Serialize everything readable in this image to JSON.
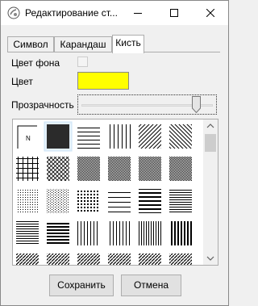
{
  "window": {
    "title": "Редактирование ст...",
    "controls": [
      "minimize-icon",
      "maximize-icon",
      "close-icon"
    ]
  },
  "tabs": [
    {
      "label": "Символ",
      "active": false
    },
    {
      "label": "Карандаш",
      "active": false
    },
    {
      "label": "Кисть",
      "active": true
    }
  ],
  "form": {
    "background_color_label": "Цвет фона",
    "background_color_checked": false,
    "color_label": "Цвет",
    "color_value": "#ffff00",
    "transparency_label": "Прозрачность",
    "transparency_fraction": 0.88
  },
  "patterns": {
    "selected_index": 1,
    "items": [
      {
        "type": "none",
        "glyph": "N"
      },
      {
        "type": "solid"
      },
      {
        "type": "horizontal"
      },
      {
        "type": "vertical"
      },
      {
        "type": "fdiag"
      },
      {
        "type": "bdiag"
      },
      {
        "type": "cross"
      },
      {
        "type": "diagcross"
      },
      {
        "type": "dense-dots"
      },
      {
        "type": "dense-dots"
      },
      {
        "type": "dense-dots"
      },
      {
        "type": "dense-dots"
      },
      {
        "type": "dots-fine"
      },
      {
        "type": "dots-medium"
      },
      {
        "type": "dots-coarse"
      },
      {
        "type": "horizontal-wide"
      },
      {
        "type": "horizontal-bold"
      },
      {
        "type": "horizontal-dense"
      },
      {
        "type": "horizontal-dense"
      },
      {
        "type": "horizontal-narrow"
      },
      {
        "type": "vertical-fine"
      },
      {
        "type": "vertical-fine"
      },
      {
        "type": "vertical-medium"
      },
      {
        "type": "vertical-bold"
      },
      {
        "type": "diag-short"
      },
      {
        "type": "diag-short"
      },
      {
        "type": "diag-short"
      },
      {
        "type": "diag-short"
      },
      {
        "type": "diag-short"
      },
      {
        "type": "diag-short"
      }
    ]
  },
  "buttons": {
    "save": "Сохранить",
    "cancel": "Отмена"
  }
}
